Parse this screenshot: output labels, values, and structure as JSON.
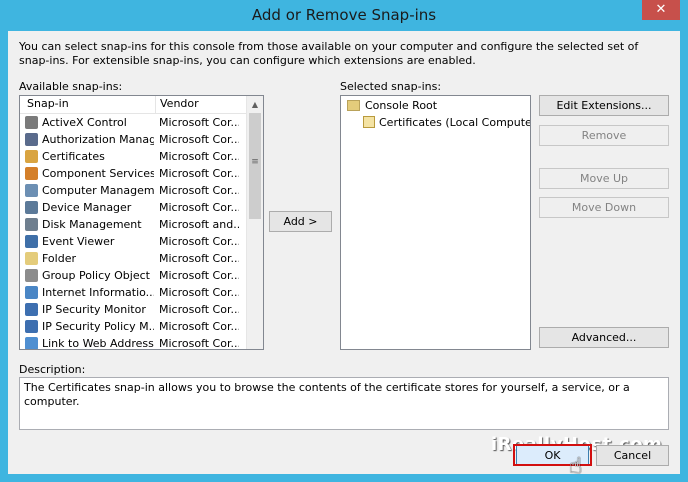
{
  "window": {
    "title": "Add or Remove Snap-ins",
    "close_glyph": "✕"
  },
  "intro_text": "You can select snap-ins for this console from those available on your computer and configure the selected set of snap-ins. For extensible snap-ins, you can configure which extensions are enabled.",
  "available": {
    "label": "Available snap-ins:",
    "columns": [
      "Snap-in",
      "Vendor"
    ],
    "rows": [
      {
        "name": "ActiveX Control",
        "vendor": "Microsoft Cor...",
        "icon": "activex-icon",
        "color": "#7a7a7a"
      },
      {
        "name": "Authorization Manager",
        "vendor": "Microsoft Cor...",
        "icon": "authorization-manager-icon",
        "color": "#5a6b8c"
      },
      {
        "name": "Certificates",
        "vendor": "Microsoft Cor...",
        "icon": "certificates-icon",
        "color": "#d9a441"
      },
      {
        "name": "Component Services",
        "vendor": "Microsoft Cor...",
        "icon": "component-services-icon",
        "color": "#d47f2a"
      },
      {
        "name": "Computer Managem...",
        "vendor": "Microsoft Cor...",
        "icon": "computer-management-icon",
        "color": "#6c8fb3"
      },
      {
        "name": "Device Manager",
        "vendor": "Microsoft Cor...",
        "icon": "device-manager-icon",
        "color": "#5c7a99"
      },
      {
        "name": "Disk Management",
        "vendor": "Microsoft and...",
        "icon": "disk-management-icon",
        "color": "#6f7f8f"
      },
      {
        "name": "Event Viewer",
        "vendor": "Microsoft Cor...",
        "icon": "event-viewer-icon",
        "color": "#3f6fa8"
      },
      {
        "name": "Folder",
        "vendor": "Microsoft Cor...",
        "icon": "folder-icon",
        "color": "#e4cc7b"
      },
      {
        "name": "Group Policy Object ...",
        "vendor": "Microsoft Cor...",
        "icon": "group-policy-icon",
        "color": "#8c8c8c"
      },
      {
        "name": "Internet Informatio...",
        "vendor": "Microsoft Cor...",
        "icon": "iis-icon",
        "color": "#4a86c5"
      },
      {
        "name": "IP Security Monitor",
        "vendor": "Microsoft Cor...",
        "icon": "ip-security-monitor-icon",
        "color": "#3d6fb0"
      },
      {
        "name": "IP Security Policy M...",
        "vendor": "Microsoft Cor...",
        "icon": "ip-security-policy-icon",
        "color": "#3d6fb0"
      },
      {
        "name": "Link to Web Address",
        "vendor": "Microsoft Cor...",
        "icon": "web-link-icon",
        "color": "#4f8fd1"
      }
    ]
  },
  "selected": {
    "label": "Selected snap-ins:",
    "root": "Console Root",
    "child": "Certificates (Local Computer)"
  },
  "buttons": {
    "add": "Add >",
    "edit_extensions": "Edit Extensions...",
    "remove": "Remove",
    "move_up": "Move Up",
    "move_down": "Move Down",
    "advanced": "Advanced...",
    "ok": "OK",
    "cancel": "Cancel"
  },
  "description": {
    "label": "Description:",
    "text": "The Certificates snap-in allows you to browse the contents of the certificate stores for yourself, a service, or a computer."
  },
  "watermark": "iReallyHost.com",
  "colors": {
    "window_frame": "#3fb5e0",
    "close_button": "#c7504b",
    "ok_highlight": "#d20f0f"
  }
}
